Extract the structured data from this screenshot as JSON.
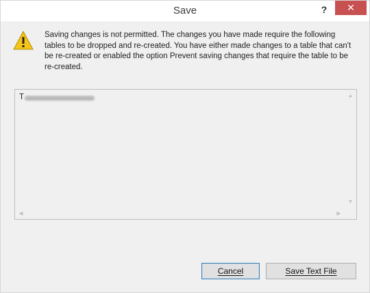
{
  "window": {
    "title": "Save",
    "help_label": "?",
    "close_label": "✕"
  },
  "message": {
    "text": "Saving changes is not permitted. The changes you have made require the following tables to be dropped and re-created. You have either made changes to a table that can't be re-created or enabled the option Prevent saving changes that require the table to be re-created."
  },
  "details": {
    "first_char": "T"
  },
  "buttons": {
    "cancel": "Cancel",
    "save_text_file": "Save Text File"
  },
  "colors": {
    "close_button_bg": "#c75050",
    "warning_fill": "#f5c518"
  }
}
